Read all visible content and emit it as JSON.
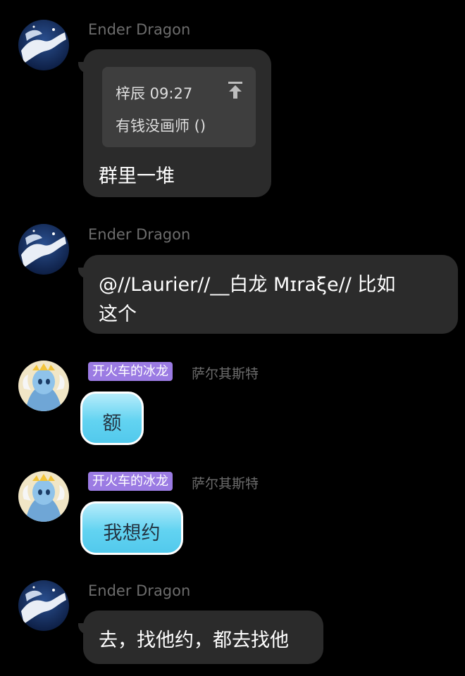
{
  "colors": {
    "background": "#000000",
    "bubble_dark": "#2b2b2b",
    "quote_box": "#3e3e3e",
    "bubble_blue": "#62d3f1",
    "badge_purple": "#9b7be3",
    "name_gray": "#6c6c6c"
  },
  "messages": [
    {
      "sender": "Ender Dragon",
      "avatar_icon": "white-dragon-avatar-icon",
      "quote": {
        "author_time": "梓辰 09:27",
        "text": "有钱没画师 ()",
        "icon": "jump-to-original-icon"
      },
      "text": "群里一堆"
    },
    {
      "sender": "Ender Dragon",
      "avatar_icon": "white-dragon-avatar-icon",
      "text_line1": "@//Laurier//__白龙 Mɪraξe// 比如",
      "text_line2": "这个"
    },
    {
      "title_badge": "开火车的冰龙",
      "sender": "萨尔其斯特",
      "avatar_icon": "blue-dragon-avatar-icon",
      "text": "额"
    },
    {
      "title_badge": "开火车的冰龙",
      "sender": "萨尔其斯特",
      "avatar_icon": "blue-dragon-avatar-icon",
      "text": "我想约"
    },
    {
      "sender": "Ender Dragon",
      "avatar_icon": "white-dragon-avatar-icon",
      "text": "去，找他约，都去找他"
    }
  ]
}
